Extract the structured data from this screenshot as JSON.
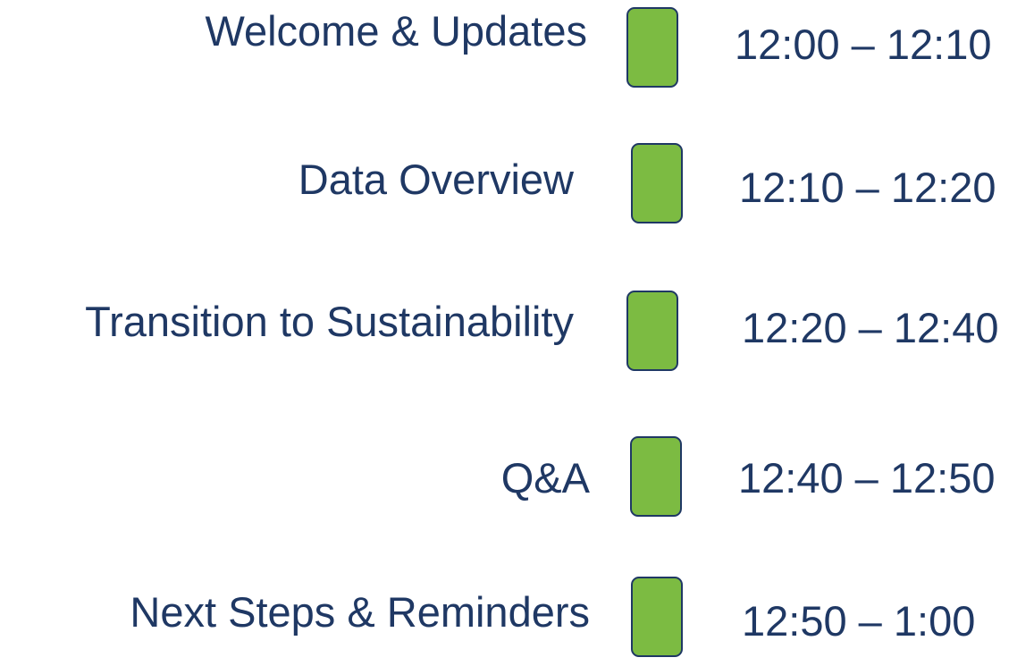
{
  "agenda": {
    "items": [
      {
        "topic": "Welcome & Updates",
        "time": "12:00 – 12:10"
      },
      {
        "topic": "Data Overview",
        "time": "12:10 – 12:20"
      },
      {
        "topic": "Transition to Sustainability",
        "time": "12:20 – 12:40"
      },
      {
        "topic": "Q&A",
        "time": "12:40 – 12:50"
      },
      {
        "topic": "Next Steps & Reminders",
        "time": "12:50 – 1:00"
      }
    ],
    "colors": {
      "text": "#1f3864",
      "marker_fill": "#7cbb42",
      "marker_border": "#1f3864"
    }
  }
}
